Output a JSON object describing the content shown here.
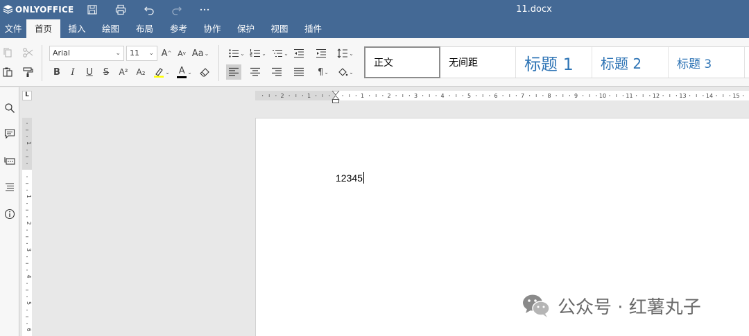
{
  "app": {
    "brand": "ONLYOFFICE",
    "document_title": "11.docx"
  },
  "menu": {
    "tabs": [
      {
        "label": "文件",
        "active": false
      },
      {
        "label": "首页",
        "active": true
      },
      {
        "label": "插入",
        "active": false
      },
      {
        "label": "绘图",
        "active": false
      },
      {
        "label": "布局",
        "active": false
      },
      {
        "label": "参考",
        "active": false
      },
      {
        "label": "协作",
        "active": false
      },
      {
        "label": "保护",
        "active": false
      },
      {
        "label": "视图",
        "active": false
      },
      {
        "label": "插件",
        "active": false
      }
    ]
  },
  "toolbar": {
    "font_name": "Arial",
    "font_size": "11",
    "bold_label": "B",
    "italic_label": "I",
    "underline_label": "U",
    "strike_label": "S",
    "superscript_label": "A²",
    "subscript_label": "A₂",
    "grow_label": "A",
    "shrink_label": "A",
    "case_label": "Aa",
    "font_color_label": "A",
    "highlight_color": "#ffff00",
    "font_color": "#000000",
    "pilcrow_label": "¶"
  },
  "styles": [
    {
      "label": "正文",
      "selected": true
    },
    {
      "label": "无间距",
      "selected": false
    },
    {
      "label": "标题 1",
      "selected": false
    },
    {
      "label": "标题 2",
      "selected": false
    },
    {
      "label": "标题 3",
      "selected": false
    }
  ],
  "sidebar": {
    "icons": [
      "search-icon",
      "comments-icon",
      "chat-icon",
      "navigation-icon",
      "about-icon"
    ]
  },
  "ruler": {
    "corner_label": "L",
    "horizontal_labels": [
      "2",
      "1",
      "1",
      "2",
      "3",
      "4",
      "5",
      "6",
      "7",
      "8",
      "9",
      "10",
      "11",
      "12",
      "13",
      "14",
      "15"
    ],
    "vertical_labels": [
      "1",
      "1",
      "2",
      "3",
      "4",
      "5",
      "6"
    ]
  },
  "document": {
    "text": "12345"
  },
  "watermark": {
    "text": "公众号 · 红薯丸子"
  },
  "colors": {
    "accent": "#446995",
    "heading_blue": "#2e74b5"
  }
}
